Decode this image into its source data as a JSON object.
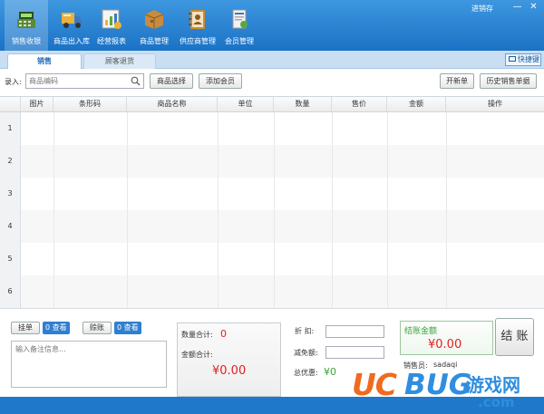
{
  "window": {
    "title": "进销存",
    "minimize_symbol": "—",
    "close_symbol": "✕"
  },
  "nav": {
    "items": [
      {
        "label": "销售收银",
        "icon": "cash-register-icon"
      },
      {
        "label": "商品出入库",
        "icon": "truck-icon"
      },
      {
        "label": "经营报表",
        "icon": "report-chart-icon"
      },
      {
        "label": "商品管理",
        "icon": "package-box-icon"
      },
      {
        "label": "供应商管理",
        "icon": "address-book-icon"
      },
      {
        "label": "会员管理",
        "icon": "member-card-icon"
      }
    ],
    "active_index": 0
  },
  "tabs": {
    "active_label": "销售",
    "inactive_label": "顾客退货"
  },
  "shortcut_button": "快捷键",
  "toolbar": {
    "entry_label": "录入:",
    "search_placeholder": "商品编码",
    "select_product": "商品选择",
    "add_member": "添加会员",
    "new_order": "开新单",
    "history": "历史销售单据"
  },
  "table": {
    "columns": [
      "图片",
      "条形码",
      "商品名称",
      "单位",
      "数量",
      "售价",
      "金额",
      "操作"
    ],
    "row_numbers": [
      "1",
      "2",
      "3",
      "4",
      "5",
      "6"
    ]
  },
  "bottom": {
    "hang_order": {
      "label": "挂单",
      "count": "0",
      "action": "查看"
    },
    "credit": {
      "label": "赊账",
      "count": "0",
      "action": "查看"
    },
    "note_placeholder": "输入备注信息...",
    "qty_total_label": "数量合计:",
    "qty_total_value": "0",
    "amount_total_label": "金额合计:",
    "amount_total_value": "¥0.00",
    "discount_label": "折  扣:",
    "reduce_label": "减免额:",
    "total_discount_label": "总优惠:",
    "total_discount_value": "¥0",
    "checkout_amount_label": "结账金额",
    "checkout_amount_value": "¥0.00",
    "checkout_button": "结 账",
    "cashier_label": "销售员:",
    "cashier_value": "sadaqi"
  },
  "watermark": {
    "uc": "UC",
    "bug": "BUG",
    "cn": "游戏网",
    "domain": ".com"
  },
  "colors": {
    "topbar": "#1b72c6",
    "accent_red": "#e32020",
    "checkout_green": "#3aa33a",
    "watermark_orange": "#f06a1e",
    "watermark_blue": "#2f8ee0"
  }
}
